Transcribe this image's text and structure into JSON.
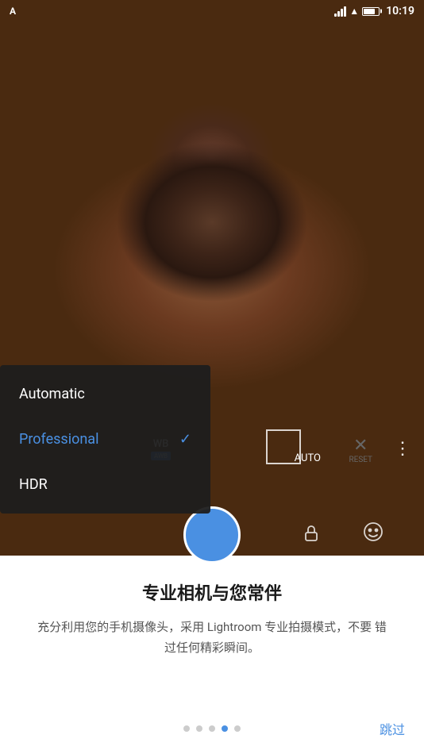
{
  "status_bar": {
    "time": "10:19",
    "battery_level": 75
  },
  "camera": {
    "wb_label": "WB",
    "awb_badge": "AWB",
    "auto_label": "AUTO",
    "reset_label": "RESET",
    "more_icon": "⋮"
  },
  "dropdown": {
    "items": [
      {
        "id": "automatic",
        "label": "Automatic",
        "active": false
      },
      {
        "id": "professional",
        "label": "Professional",
        "active": true
      },
      {
        "id": "hdr",
        "label": "HDR",
        "active": false
      }
    ]
  },
  "onboarding": {
    "title": "专业相机与您常伴",
    "description": "充分利用您的手机摄像头，采用\nLightroom 专业拍摄模式，不要\n错过任何精彩瞬间。",
    "dots": [
      {
        "id": 1,
        "active": false
      },
      {
        "id": 2,
        "active": false
      },
      {
        "id": 3,
        "active": false
      },
      {
        "id": 4,
        "active": true
      },
      {
        "id": 5,
        "active": false
      }
    ],
    "skip_label": "跳过"
  },
  "colors": {
    "accent": "#4a90e2",
    "text_primary": "#1a1a1a",
    "text_secondary": "#555555"
  }
}
